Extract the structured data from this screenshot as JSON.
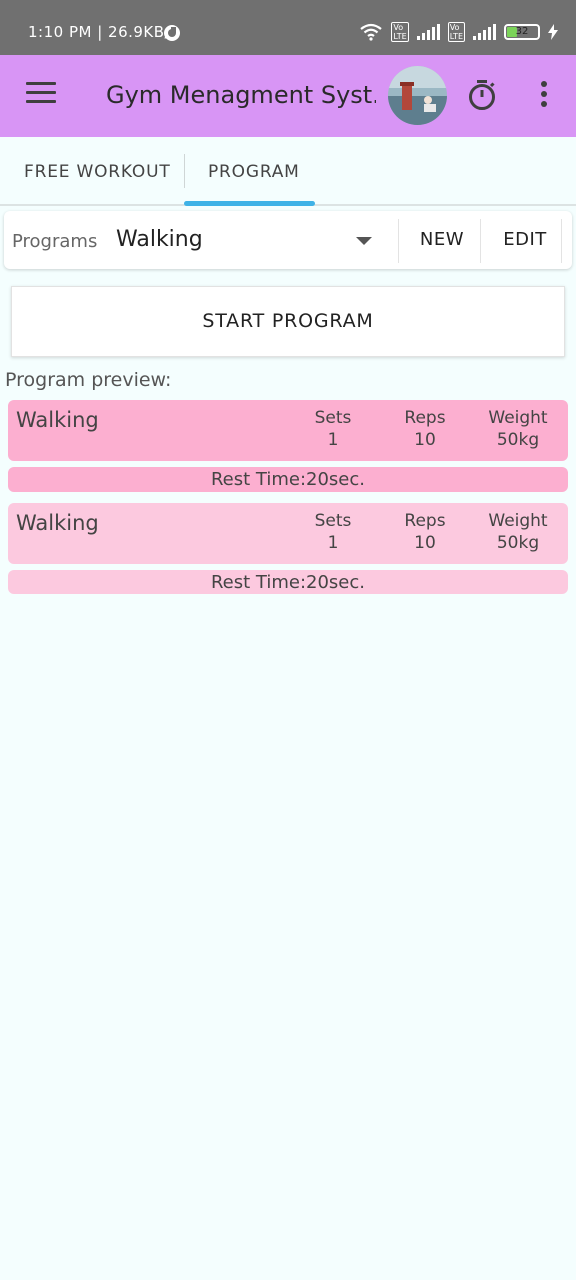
{
  "status": {
    "time": "1:10 PM | 26.9KB/s",
    "battery": "32",
    "icons": [
      "app-notification-icon",
      "wifi-icon",
      "volte-icon",
      "signal-icon",
      "battery-icon",
      "charging-icon"
    ]
  },
  "appbar": {
    "title": "Gym Menagment Syst...",
    "background": "#d895f5",
    "icons": [
      "menu-icon",
      "avatar",
      "timer-icon",
      "more-vert-icon"
    ]
  },
  "tabs": {
    "items": [
      "FREE WORKOUT",
      "PROGRAM"
    ],
    "selected": "PROGRAM",
    "indicator_color": "#3fb2e6"
  },
  "programs": {
    "label": "Programs",
    "selected": "Walking",
    "new_label": "NEW",
    "edit_label": "EDIT"
  },
  "start_label": "START PROGRAM",
  "preview_label": "Program preview:",
  "preview": [
    {
      "name": "Walking",
      "sets_label": "Sets",
      "sets": "1",
      "reps_label": "Reps",
      "reps": "10",
      "weight_label": "Weight",
      "weight": "50kg",
      "rest": "Rest Time:20sec.",
      "color": "#fcafd0"
    },
    {
      "name": "Walking",
      "sets_label": "Sets",
      "sets": "1",
      "reps_label": "Reps",
      "reps": "10",
      "weight_label": "Weight",
      "weight": "50kg",
      "rest": "Rest Time:20sec.",
      "color": "#fcc9df"
    }
  ]
}
